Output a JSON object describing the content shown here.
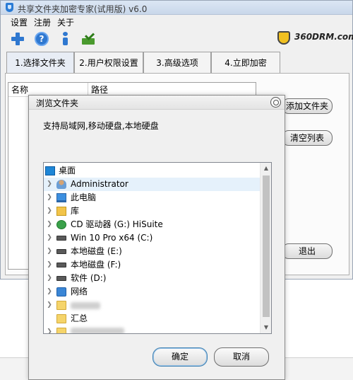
{
  "window": {
    "title": "共享文件夹加密专家(试用版) v6.0"
  },
  "menu": {
    "settings": "设置",
    "register": "注册",
    "about": "关于"
  },
  "toolbar": {
    "icons": [
      "add-icon",
      "help-icon",
      "info-icon",
      "encrypt-icon"
    ]
  },
  "brand": {
    "text": "360DRM.com"
  },
  "tabs": [
    {
      "label": "1.选择文件夹",
      "active": true
    },
    {
      "label": "2.用户权限设置",
      "active": false
    },
    {
      "label": "3.高级选项",
      "active": false
    },
    {
      "label": "4.立即加密",
      "active": false
    }
  ],
  "filelist": {
    "columns": [
      "名称",
      "路径"
    ]
  },
  "side_buttons": {
    "add": "添加文件夹",
    "clear": "清空列表",
    "exit": "退出"
  },
  "dialog": {
    "title": "浏览文件夹",
    "description": "支持局域网,移动硬盘,本地硬盘",
    "tree": [
      {
        "label": "桌面",
        "icon": "desktop-icon"
      },
      {
        "label": "Administrator",
        "icon": "user-icon",
        "selected": true
      },
      {
        "label": "此电脑",
        "icon": "computer-icon"
      },
      {
        "label": "库",
        "icon": "library-icon"
      },
      {
        "label": "CD 驱动器 (G:) HiSuite",
        "icon": "cd-drive-icon"
      },
      {
        "label": "Win 10 Pro x64 (C:)",
        "icon": "drive-icon"
      },
      {
        "label": "本地磁盘 (E:)",
        "icon": "drive-icon"
      },
      {
        "label": "本地磁盘 (F:)",
        "icon": "drive-icon"
      },
      {
        "label": "软件 (D:)",
        "icon": "drive-icon"
      },
      {
        "label": "网络",
        "icon": "network-icon"
      },
      {
        "label": "",
        "icon": "folder-icon"
      },
      {
        "label": "汇总",
        "icon": "folder-icon"
      },
      {
        "label": "",
        "icon": "folder-icon"
      }
    ],
    "ok": "确定",
    "cancel": "取消"
  }
}
